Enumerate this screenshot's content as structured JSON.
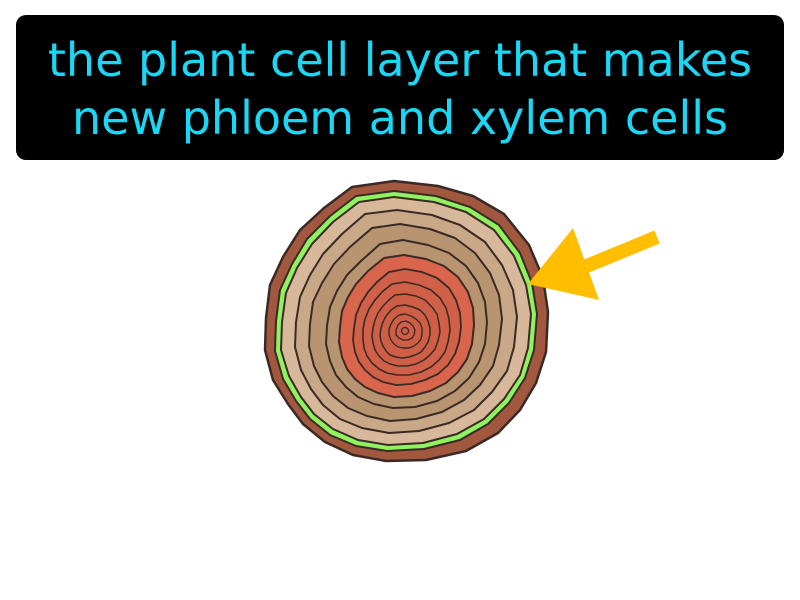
{
  "definition": {
    "line_1": "the plant cell layer that makes",
    "line_2": "new phloem and xylem cells"
  },
  "colors": {
    "caption_background": "#000000",
    "caption_text": "#1ad7f5",
    "bark": "#a2573f",
    "cambium": "#8ef35f",
    "outer_wood": "#d8b89a",
    "mid_wood": "#b89570",
    "heartwood": "#d8654c",
    "arrow": "#ffbf00",
    "outline": "#3a2a25"
  },
  "icons": {
    "illustration": "tree-trunk-cross-section-icon",
    "pointer": "arrow-icon"
  }
}
